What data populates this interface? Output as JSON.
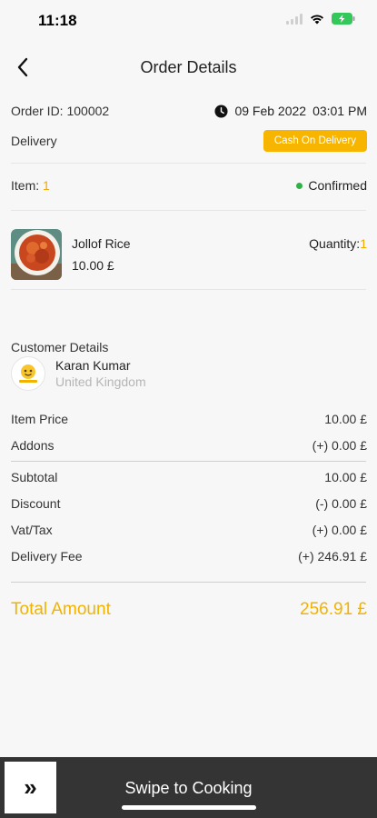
{
  "status_bar": {
    "time": "11:18"
  },
  "header": {
    "title": "Order Details",
    "back_icon": "chevron-left-icon"
  },
  "order": {
    "id_label": "Order ID: 100002",
    "date": "09 Feb 2022",
    "time": "03:01 PM",
    "delivery_type": "Delivery",
    "payment_method": "Cash On Delivery",
    "item_label": "Item: ",
    "item_count": "1",
    "status": "Confirmed"
  },
  "items": [
    {
      "name": "Jollof Rice",
      "price": "10.00 £",
      "quantity_label": "Quantity:",
      "quantity": "1"
    }
  ],
  "customer": {
    "heading": "Customer Details",
    "name": "Karan Kumar",
    "country": "United Kingdom"
  },
  "pricing": {
    "item_price_label": "Item Price",
    "item_price": "10.00 £",
    "addons_label": "Addons",
    "addons": "(+) 0.00 £",
    "subtotal_label": "Subtotal",
    "subtotal": "10.00 £",
    "discount_label": "Discount",
    "discount": "(-) 0.00 £",
    "vat_label": "Vat/Tax",
    "vat": "(+) 0.00 £",
    "delivery_fee_label": "Delivery Fee",
    "delivery_fee": "(+) 246.91 £",
    "total_label": "Total Amount",
    "total": "256.91 £"
  },
  "bottom": {
    "swipe_label": "Swipe to Cooking",
    "swipe_handle": "»"
  },
  "colors": {
    "accent": "#f7b500",
    "status_green": "#2fb344",
    "bottom_bar": "#343434"
  }
}
